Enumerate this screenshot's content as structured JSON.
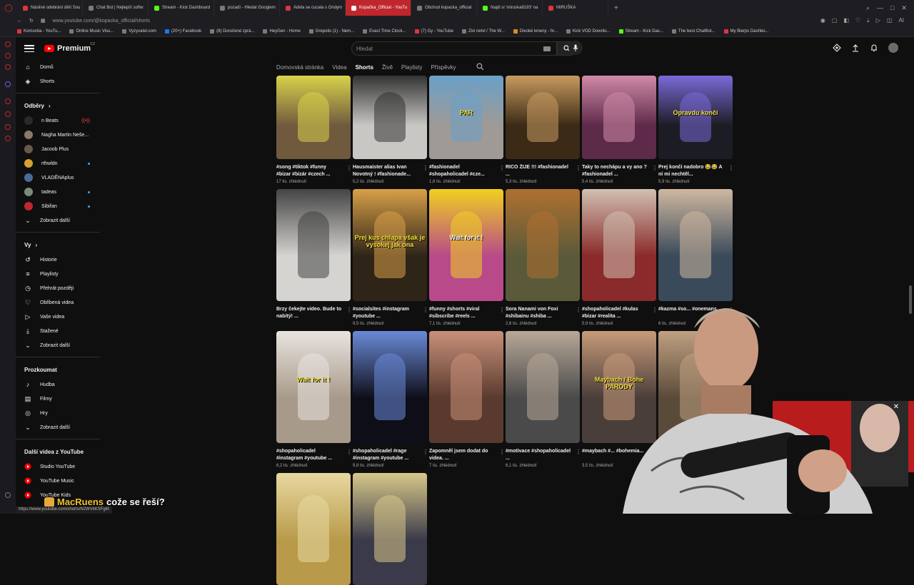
{
  "browser": {
    "tabs": [
      {
        "label": "Násilné odebrání dětí Sou",
        "color": "#e0343e",
        "active": false
      },
      {
        "label": "Chat Bot | Nejlepší softw",
        "color": "#7a7a7a",
        "active": false
      },
      {
        "label": "Stream - Kick Dashboard",
        "color": "#53fc18",
        "active": false
      },
      {
        "label": "pozadí - Hledat Googlem",
        "color": "#7a7a7a",
        "active": false
      },
      {
        "label": "Adéla se cucala s Ondym",
        "color": "#e0343e",
        "active": false
      },
      {
        "label": "Kopačka_Official - YouTu",
        "color": "#ffffff",
        "active": true
      },
      {
        "label": "Obchod kopacka_official",
        "color": "#7a7a7a",
        "active": false
      },
      {
        "label": "Najdi si 'miruska8193' na",
        "color": "#53fc18",
        "active": false
      },
      {
        "label": "MIRUŠKA",
        "color": "#e0343e",
        "active": false
      }
    ],
    "url": "www.youtube.com/@kopacka_official/shorts",
    "bookmarks": [
      {
        "label": "Komunita - YouTu...",
        "color": "#e0343e"
      },
      {
        "label": "Online Music Visu...",
        "color": "#7a7a7a"
      },
      {
        "label": "Vyzyvatel.com",
        "color": "#7a7a7a"
      },
      {
        "label": "(20+) Facebook",
        "color": "#1877f2"
      },
      {
        "label": "(8) Doručené zprá...",
        "color": "#7a7a7a"
      },
      {
        "label": "HeyGen - Home",
        "color": "#7a7a7a"
      },
      {
        "label": "Grepolis (1) - Nem...",
        "color": "#7a7a7a"
      },
      {
        "label": "Exact Time Clock...",
        "color": "#7a7a7a"
      },
      {
        "label": "(7) Gy - YouTube",
        "color": "#e0343e"
      },
      {
        "label": "Zivi netvl / The W...",
        "color": "#7a7a7a"
      },
      {
        "label": "Divoké kmeny - hr...",
        "color": "#e08a20"
      },
      {
        "label": "Kick VOD Downlo...",
        "color": "#7a7a7a"
      },
      {
        "label": "Stream - Kick Das...",
        "color": "#53fc18"
      },
      {
        "label": "The best ChatBot...",
        "color": "#7a7a7a"
      },
      {
        "label": "My Bierps Dashbo...",
        "color": "#e0343e"
      }
    ],
    "status_url": "https://www.youtube.com/shorts/N2WVkKSFgM"
  },
  "header": {
    "logo": "Premium",
    "logo_sup": "CZ",
    "search_placeholder": "Hledat"
  },
  "sidebar": {
    "main": [
      {
        "label": "Domů",
        "icon": "home-icon",
        "glyph": "⌂"
      },
      {
        "label": "Shorts",
        "icon": "shorts-icon",
        "glyph": "◈"
      }
    ],
    "subs_title": "Odběry",
    "subs": [
      {
        "label": "n Beats",
        "color": "#2a2a2a",
        "badge": "live"
      },
      {
        "label": "Nagha Martin Neše...",
        "color": "#8a7a6a",
        "badge": ""
      },
      {
        "label": "Jacoob Plus",
        "color": "#6a5a4a",
        "badge": ""
      },
      {
        "label": "rthwldn",
        "color": "#d8a030",
        "badge": "dot"
      },
      {
        "label": "VLADĚNAplus",
        "color": "#4a6a9a",
        "badge": ""
      },
      {
        "label": "tadeas",
        "color": "#7a8a7a",
        "badge": "dot"
      },
      {
        "label": "Sibiřan",
        "color": "#c0272d",
        "badge": "dot"
      }
    ],
    "subs_more": "Zobrazit další",
    "you_title": "Vy",
    "you": [
      {
        "label": "Historie",
        "icon": "history-icon",
        "glyph": "↺"
      },
      {
        "label": "Playlisty",
        "icon": "playlist-icon",
        "glyph": "≡"
      },
      {
        "label": "Přehrát později",
        "icon": "clock-icon",
        "glyph": "◷"
      },
      {
        "label": "Oblíbená videa",
        "icon": "like-icon",
        "glyph": "♡"
      },
      {
        "label": "Vaše videa",
        "icon": "video-icon",
        "glyph": "▷"
      },
      {
        "label": "Stažené",
        "icon": "download-icon",
        "glyph": "⤓"
      }
    ],
    "you_more": "Zobrazit další",
    "explore_title": "Prozkoumat",
    "explore": [
      {
        "label": "Hudba",
        "icon": "music-icon",
        "glyph": "♪"
      },
      {
        "label": "Filmy",
        "icon": "film-icon",
        "glyph": "▤"
      },
      {
        "label": "Hry",
        "icon": "gamepad-icon",
        "glyph": "◎"
      }
    ],
    "explore_more": "Zobrazit další",
    "more_title": "Další videa z YouTube",
    "more": [
      {
        "label": "Studio YouTube",
        "icon": "studio-icon"
      },
      {
        "label": "YouTube Music",
        "icon": "ytmusic-icon"
      },
      {
        "label": "YouTube Kids",
        "icon": "ytkids-icon"
      }
    ]
  },
  "channel_tabs": [
    {
      "label": "Domovská stránka",
      "active": false
    },
    {
      "label": "Videa",
      "active": false
    },
    {
      "label": "Shorts",
      "active": true
    },
    {
      "label": "Živě",
      "active": false
    },
    {
      "label": "Playlisty",
      "active": false
    },
    {
      "label": "Příspěvky",
      "active": false
    }
  ],
  "shorts": [
    [
      {
        "title": "#song #tiktok #funny #bizar #bizár #czech ...",
        "views": "17 tis. zhlédnutí",
        "bg": "#6f5a3e",
        "accent": "#d8d24a",
        "overlay": ""
      },
      {
        "title": "Hausmaister alias Ivan Novotný ! #fashionade...",
        "views": "5,2 tis. zhlédnutí",
        "bg": "#c9c7c4",
        "accent": "#333333",
        "overlay": ""
      },
      {
        "title": "#fashionadel #shopaholicadel #cze...",
        "views": "1,6 tis. zhlédnutí",
        "bg": "#9f9a96",
        "accent": "#6aa0c8",
        "overlay": "PAR"
      },
      {
        "title": "RICO ŽIJE !!! #fashionadel ...",
        "views": "5,3 tis. zhlédnutí",
        "bg": "#3a2a16",
        "accent": "#c89a60",
        "overlay": ""
      },
      {
        "title": "Taky to nechápu a vy ano ? #fashionadel ...",
        "views": "5,4 tis. zhlédnutí",
        "bg": "#5e2a4a",
        "accent": "#d08aa8",
        "overlay": ""
      },
      {
        "title": "Prej končí nadobro 😂😂 A ní mi nechtěl...",
        "views": "5,9 tis. zhlédnutí",
        "bg": "#1c1c24",
        "accent": "#7a6ad8",
        "overlay": "Opravdu končí"
      }
    ],
    [
      {
        "title": "Brzy čekejte video. Bude to nabitý! ...",
        "views": "",
        "bg": "#d6d4d0",
        "accent": "#444444",
        "overlay": ""
      },
      {
        "title": "#socialsites #instagram #youtube ...",
        "views": "9,5 tis. zhlédnutí",
        "bg": "#2e2418",
        "accent": "#d8a048",
        "overlay": "Prej kus chlapa však je vysokej jak ona"
      },
      {
        "title": "#funny #shorts #viral #sibscribe #reels ...",
        "views": "7,1 tis. zhlédnutí",
        "bg": "#b84a8a",
        "accent": "#f0d020",
        "overlay": "Wait for it !"
      },
      {
        "title": "Sora Nanami von Foxi #shibainu #shiba ...",
        "views": "2,6 tis. zhlédnutí",
        "bg": "#5a5a3a",
        "accent": "#b07030",
        "overlay": ""
      },
      {
        "title": "#shopaholicadel #kulas #bizar #realita ...",
        "views": "5,9 tis. zhlédnutí",
        "bg": "#8a2a2a",
        "accent": "#d0c0b0",
        "overlay": ""
      },
      {
        "title": "#kazma #so... #onemans...",
        "views": "6 tis. zhlédnutí",
        "bg": "#3a4a5a",
        "accent": "#d0b8a0",
        "overlay": ""
      }
    ],
    [
      {
        "title": "#shopaholicadel #instagram #youtube ...",
        "views": "6,2 tis. zhlédnutí",
        "bg": "#a89a8a",
        "accent": "#e8e4e0",
        "overlay": "Wait for it !"
      },
      {
        "title": "#shopaholicadel #rage #instagram #youtube ...",
        "views": "9,8 tis. zhlédnutí",
        "bg": "#0e0e18",
        "accent": "#6a8ad8",
        "overlay": ""
      },
      {
        "title": "Zapomněl jsem dodat do videa. ...",
        "views": "7 tis. zhlédnutí",
        "bg": "#5a3a2e",
        "accent": "#c8907a",
        "overlay": ""
      },
      {
        "title": "#motivace #shopaholicadel ...",
        "views": "6,1 tis. zhlédnutí",
        "bg": "#4a4a4a",
        "accent": "#b8a898",
        "overlay": ""
      },
      {
        "title": "#maybach #... #bohemia...",
        "views": "3,5 tis. zhlédnutí",
        "bg": "#4a3e3a",
        "accent": "#c89a7a",
        "overlay": "Maybach / Bohe PARODY"
      },
      {
        "title": "",
        "views": "",
        "bg": "#5a4a3a",
        "accent": "#c0a080",
        "overlay": ""
      }
    ],
    [
      {
        "title": "",
        "views": "",
        "bg": "#b89a4a",
        "accent": "#e8d8a0",
        "overlay": ""
      },
      {
        "title": "",
        "views": "",
        "bg": "#3a3a4a",
        "accent": "#d8c88a",
        "overlay": ""
      }
    ]
  ],
  "caption": {
    "name": "MacRuens",
    "message": "cože se řeší?"
  }
}
